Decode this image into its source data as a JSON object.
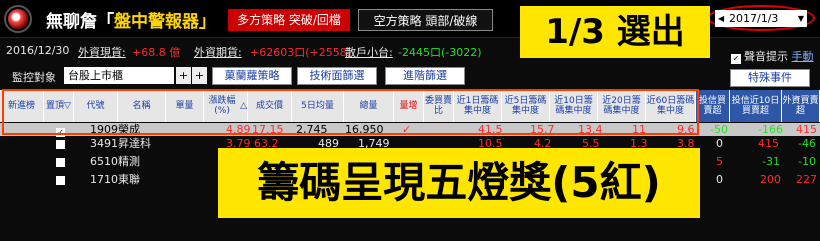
{
  "app": {
    "brand_prefix": "無聊詹「",
    "brand_name": "盤中警報器",
    "brand_suffix": "」",
    "strategy_long": "多方策略 突破/回檔",
    "strategy_short": "空方策略 頭部/破線",
    "date_value": "2017/1/3",
    "date_left_arrow": "◀",
    "date_right_arrow": "▼"
  },
  "info": {
    "date": "2016/12/30",
    "cash_label": "外資現貨:",
    "cash_value": "+68.8 億",
    "futures_label": "外資期貨:",
    "futures_value": "+62603口(+2558)",
    "retail_label": "散戶小台:",
    "retail_value": "-2445口(-3022)"
  },
  "controls": {
    "monitor_label": "監控對象",
    "market": "台股上市櫃",
    "plus": "+",
    "minus": "+",
    "btn_strategy": "菓蘭蘿策略",
    "btn_tech": "技術面篩選",
    "btn_adv": "進階篩選",
    "sound_check": "✓",
    "sound_label": "聲音提示",
    "sound_manual": "手動",
    "special": "特殊事件"
  },
  "table": {
    "headers": [
      "新進榜",
      "置頂",
      "代號",
      "名稱",
      "單量",
      "漲跌幅(%)",
      "成交價",
      "5日均量",
      "總量",
      "量增",
      "委買賣比",
      "近1日籌碼集中度",
      "近5日籌碼集中度",
      "近10日籌碼集中度",
      "近20日籌碼集中度",
      "近60日籌碼集中度",
      "投信買賣超",
      "投信近10日買賣超",
      "外資買賣超"
    ],
    "sort_icon_top": "▽",
    "sort_icon_pct": "△",
    "rows": [
      {
        "check": "✓",
        "code": "1909",
        "name": "榮成",
        "pct": "4.89",
        "price": "17.15",
        "vol5": "2,745",
        "total": "16,950",
        "inc": "✓",
        "c1": "41.5",
        "c5": "15.7",
        "c10": "13.4",
        "c20": "11",
        "c60": "9.6",
        "trust": "-50",
        "trust10": "-166",
        "foreign": "415"
      },
      {
        "check": "",
        "code": "3491",
        "name": "昇達科",
        "pct": "3.79",
        "price": "63.2",
        "vol5": "489",
        "total": "1,749",
        "inc": "",
        "c1": "10.5",
        "c5": "4.2",
        "c10": "5.5",
        "c20": "1.3",
        "c60": "3.8",
        "trust": "0",
        "trust10": "415",
        "foreign": "-46"
      },
      {
        "check": "",
        "code": "6510",
        "name": "精測",
        "pct": "",
        "price": "",
        "vol5": "",
        "total": "",
        "inc": "",
        "c1": "",
        "c5": "",
        "c10": "",
        "c20": "",
        "c60": "",
        "trust": "5",
        "trust10": "-31",
        "foreign": "-10"
      },
      {
        "check": "",
        "code": "1710",
        "name": "東聯",
        "pct": "",
        "price": "",
        "vol5": "",
        "total": "",
        "inc": "",
        "c1": "",
        "c5": "",
        "c10": "",
        "c20": "",
        "c60": "",
        "trust": "0",
        "trust10": "200",
        "foreign": "227"
      }
    ]
  },
  "overlays": {
    "selected": "1/3 選出",
    "banner": "籌碼呈現五燈獎(5紅)"
  }
}
